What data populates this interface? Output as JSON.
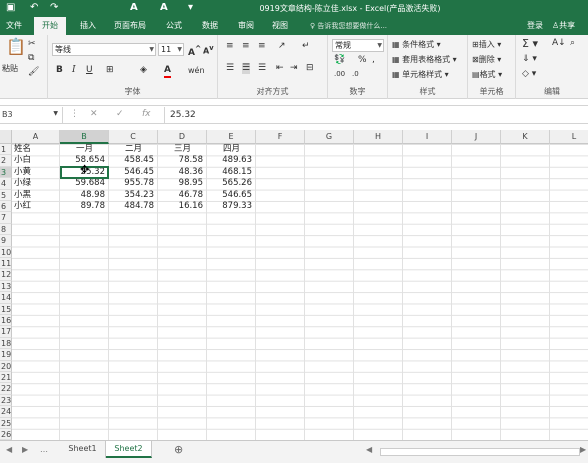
{
  "window": {
    "title": "0919文章结构-陈立佳.xlsx - Excel(产品激活失败)"
  },
  "ribbon_tabs": [
    "文件",
    "开始",
    "插入",
    "页面布局",
    "公式",
    "数据",
    "审阅",
    "视图"
  ],
  "active_tab": "开始",
  "tell_me": "告诉我您想要做什么...",
  "login": "登录",
  "share": "共享",
  "clipboard": {
    "paste": "粘贴"
  },
  "font": {
    "name": "等线",
    "size": "11",
    "group_label": "字体"
  },
  "alignment": {
    "group_label": "对齐方式"
  },
  "number": {
    "format": "常规",
    "group_label": "数字"
  },
  "styles": {
    "conditional": "条件格式",
    "table": "套用表格格式",
    "cell": "单元格样式",
    "group_label": "样式"
  },
  "cells_group": {
    "insert": "插入",
    "delete": "删除",
    "format": "格式",
    "group_label": "单元格"
  },
  "editing": {
    "group_label": "编辑"
  },
  "formula_bar": {
    "name_box": "B3",
    "value": "25.32"
  },
  "columns": [
    "A",
    "B",
    "C",
    "D",
    "E",
    "F",
    "G",
    "H",
    "I",
    "J",
    "K",
    "L"
  ],
  "selected_column": "B",
  "rows": [
    "1",
    "2",
    "3",
    "4",
    "5",
    "6",
    "7",
    "8",
    "9",
    "10",
    "11",
    "12",
    "13",
    "14",
    "15",
    "16",
    "17",
    "18",
    "19",
    "20",
    "21",
    "22",
    "23",
    "24",
    "25",
    "26"
  ],
  "selected_row": "3",
  "sheet": {
    "header": [
      "姓名",
      "一月",
      "二月",
      "三月",
      "四月"
    ],
    "data": [
      [
        "小白",
        "58.654",
        "458.45",
        "78.58",
        "489.63"
      ],
      [
        "小黄",
        "25.32",
        "546.45",
        "48.36",
        "468.15"
      ],
      [
        "小绿",
        "59.684",
        "955.78",
        "98.95",
        "565.26"
      ],
      [
        "小黑",
        "48.98",
        "354.23",
        "46.78",
        "546.65"
      ],
      [
        "小红",
        "89.78",
        "484.78",
        "16.16",
        "879.33"
      ]
    ]
  },
  "sheet_tabs": [
    "Sheet1",
    "Sheet2"
  ],
  "active_sheet": "Sheet2",
  "accent_color": "#217346"
}
